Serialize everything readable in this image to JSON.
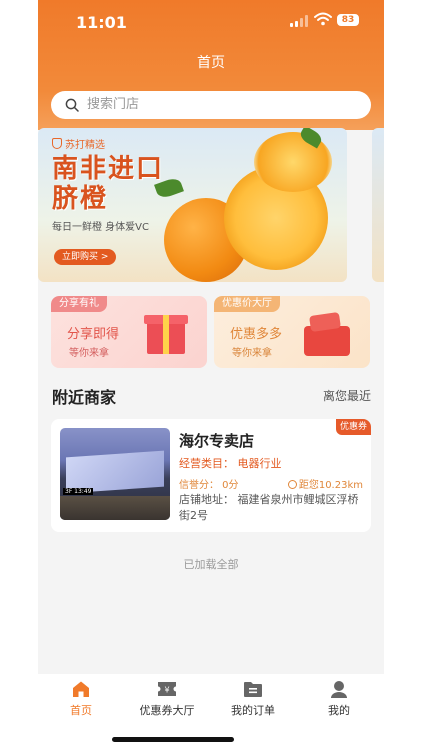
{
  "status_bar": {
    "time": "11:01",
    "battery": "83"
  },
  "header": {
    "title": "首页"
  },
  "search": {
    "placeholder": "搜索门店"
  },
  "banner": {
    "brand": "苏打精选",
    "headline_line1": "南非进口",
    "headline_line2": "脐橙",
    "slogan": "每日一鲜橙 身体爱VC",
    "cta": "立即购买 >"
  },
  "promos": [
    {
      "tag": "分享有礼",
      "main": "分享即得",
      "sub": "等你来拿"
    },
    {
      "tag": "优惠价大厅",
      "main": "优惠多多",
      "sub": "等你来拿"
    }
  ],
  "nearby": {
    "title": "附近商家",
    "sort": "离您最近"
  },
  "store": {
    "badge": "优惠券",
    "name": "海尔专卖店",
    "category": "经营类目：  电器行业",
    "rating": "信誉分：  0分",
    "distance": "距您10.23km",
    "address": "店铺地址：  福建省泉州市鲤城区浮桥街2号",
    "thumb_tag": "3F 13:49"
  },
  "list_footer": "已加载全部",
  "tabbar": [
    {
      "label": "首页",
      "icon": "home-icon",
      "active": true
    },
    {
      "label": "优惠券大厅",
      "icon": "coupon-icon",
      "active": false
    },
    {
      "label": "我的订单",
      "icon": "orders-icon",
      "active": false
    },
    {
      "label": "我的",
      "icon": "profile-icon",
      "active": false
    }
  ],
  "colors": {
    "accent": "#f07a2a",
    "price": "#e35a20",
    "background": "#f4f4f4"
  }
}
